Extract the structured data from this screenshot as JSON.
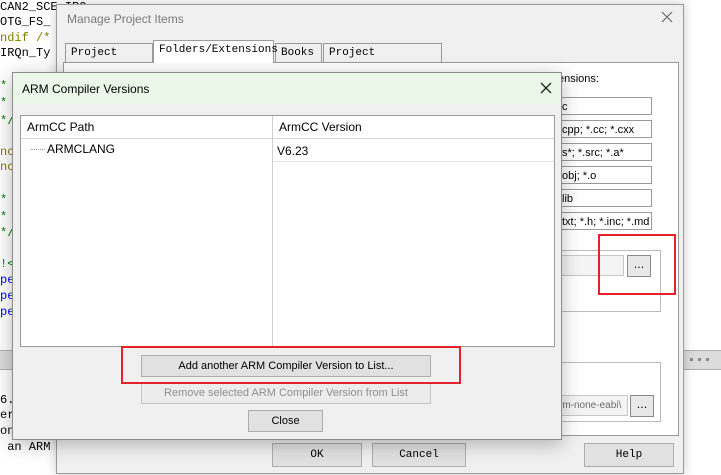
{
  "editor": {
    "lines": [
      {
        "text": "CAN2_SCE_IRQ",
        "cls": "c-black"
      },
      {
        "text": "OTG_FS_",
        "cls": "c-black"
      },
      {
        "text": "ndif /*",
        "cls": "c-olive"
      },
      {
        "text": "IRQn_Ty",
        "cls": "c-black"
      },
      {
        "text": "",
        "cls": "c-black"
      },
      {
        "text": "*",
        "cls": "c-green"
      },
      {
        "text": "*",
        "cls": "c-green"
      },
      {
        "text": "*/",
        "cls": "c-green"
      },
      {
        "text": "",
        "cls": "c-black"
      },
      {
        "text": "nc",
        "cls": "c-olive"
      },
      {
        "text": "nc",
        "cls": "c-olive"
      },
      {
        "text": "",
        "cls": "c-black"
      },
      {
        "text": "*",
        "cls": "c-green"
      },
      {
        "text": "*",
        "cls": "c-green"
      },
      {
        "text": "*/",
        "cls": "c-green"
      },
      {
        "text": "",
        "cls": "c-black"
      },
      {
        "text": "!<",
        "cls": "c-green"
      },
      {
        "text": "pe",
        "cls": "c-blue"
      },
      {
        "text": "pe",
        "cls": "c-blue"
      },
      {
        "text": "pe",
        "cls": "c-blue"
      }
    ],
    "build_output": [
      "6.",
      "er",
      "on",
      " an ARM"
    ]
  },
  "manage_dialog": {
    "title": "Manage Project Items",
    "tabs": [
      "Project Items",
      "Folders/Extensions",
      "Books",
      "Project Info/Layer"
    ],
    "active_tab": "Folders/Extensions",
    "extensions_label": "ensions:",
    "extension_fields": [
      "c",
      "cpp; *.cc; *.cxx",
      "s*; *.src; *.a*",
      "obj; *.o",
      "lib",
      "txt; *.h; *.inc; *.md"
    ],
    "browse_label": "...",
    "toolchain_value": "rm-none-eabi\\",
    "buttons": {
      "ok": "OK",
      "cancel": "Cancel",
      "help": "Help"
    }
  },
  "arm_dialog": {
    "title": "ARM Compiler Versions",
    "columns": [
      "ArmCC Path",
      "ArmCC Version"
    ],
    "rows": [
      {
        "path": "ARMCLANG",
        "version": "V6.23"
      }
    ],
    "buttons": {
      "add": "Add another ARM Compiler Version to List...",
      "remove": "Remove selected ARM Compiler Version from List",
      "close": "Close"
    }
  },
  "colors": {
    "highlight": "#e8202a",
    "title_bar": "#eaf7e9"
  }
}
